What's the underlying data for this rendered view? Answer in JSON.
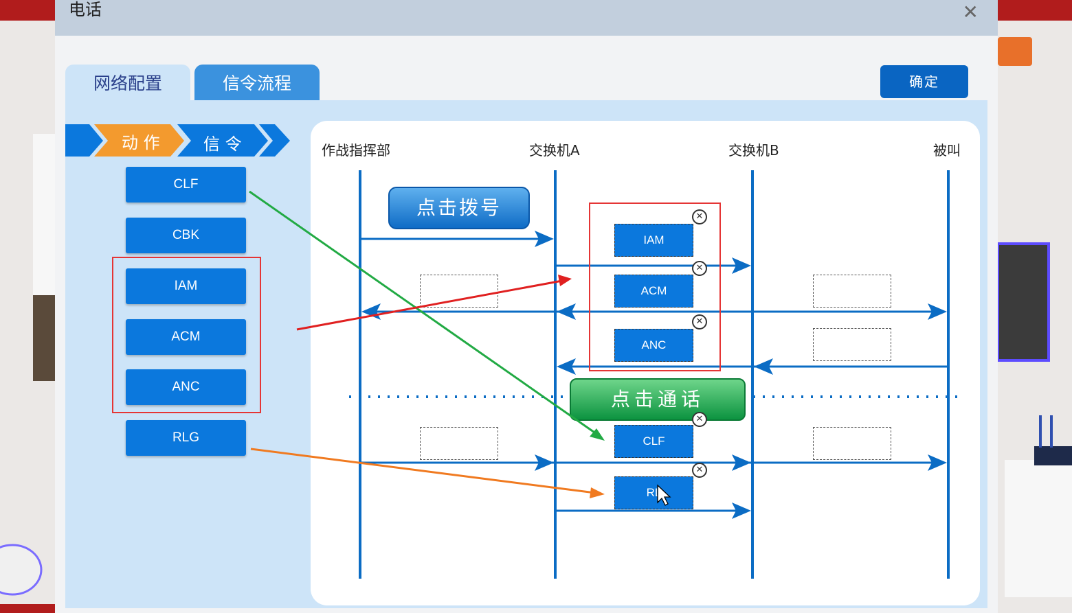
{
  "dialog": {
    "title": "电话",
    "close_icon": "close-icon",
    "tabs": [
      {
        "label": "网络配置"
      },
      {
        "label": "信令流程"
      }
    ],
    "confirm_label": "确定"
  },
  "steps": {
    "action": "动 作",
    "signal": "信 令"
  },
  "signal_buttons": [
    "CLF",
    "CBK",
    "IAM",
    "ACM",
    "ANC",
    "RLG"
  ],
  "diagram": {
    "columns": [
      "作战指挥部",
      "交换机A",
      "交换机B",
      "被叫"
    ],
    "dial_label": "点击拨号",
    "call_label": "点击通话",
    "placed": [
      "IAM",
      "ACM",
      "ANC",
      "CLF",
      "RL"
    ]
  },
  "colors": {
    "accent_blue": "#0b78dd",
    "arrow_green": "#22aa44",
    "arrow_red": "#e02020",
    "arrow_orange": "#f07a20",
    "highlight_red": "#e53535"
  }
}
